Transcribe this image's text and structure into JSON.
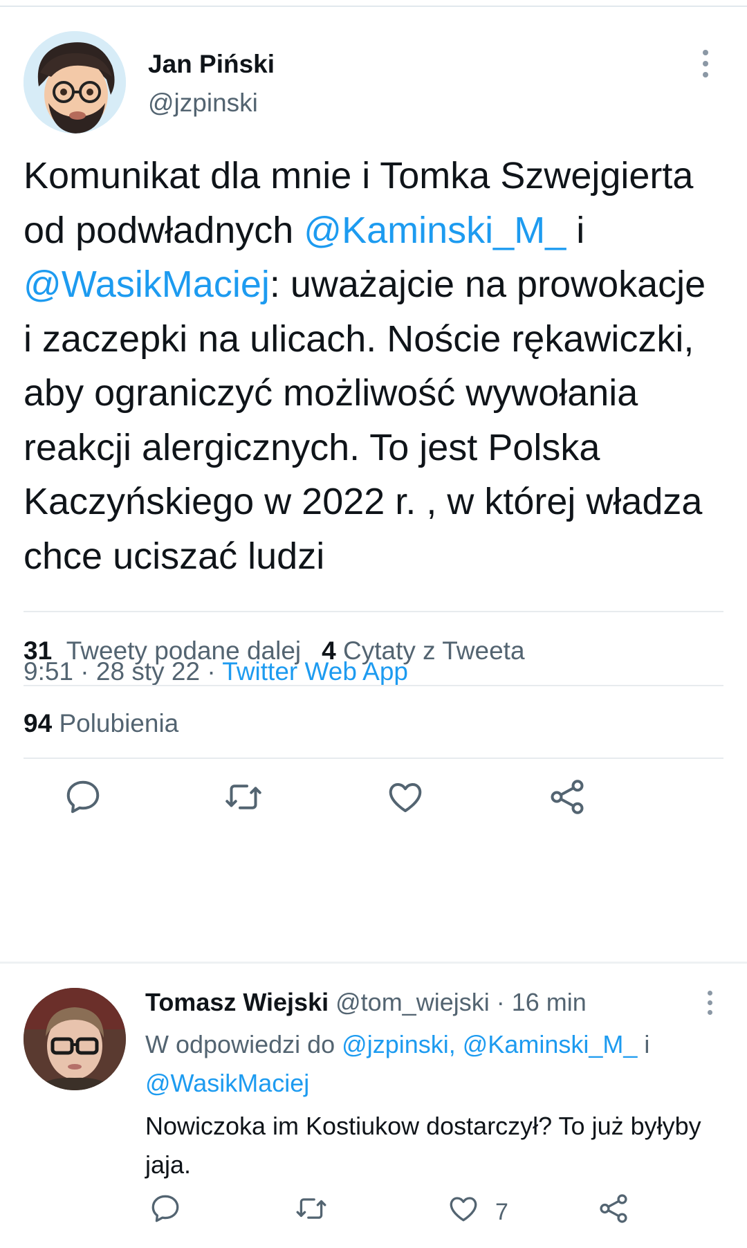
{
  "tweet": {
    "author_name": "Jan Piński",
    "author_handle": "@jzpinski",
    "text_parts": [
      "Komunikat dla mnie i Tomka Szwejgierta od podwładnych ",
      "@Kaminski_M_",
      " i ",
      "@WasikMaciej",
      ": uważajcie na prowokacje i zaczepki na ulicach. Noście rękawiczki, aby ograniczyć możliwość wywołania reakcji alergicznych. To jest Polska Kaczyńskiego w 2022 r. , w której władza chce uciszać ludzi"
    ],
    "time": "9:51",
    "date": "28 sty 22",
    "source": "Twitter Web App",
    "separator": " · ",
    "retweets_count": "31",
    "retweets_label": "Tweety podane dalej",
    "quotes_count": "4",
    "quotes_label": "Cytaty z Tweeta",
    "likes_count": "94",
    "likes_label": "Polubienia",
    "icons": [
      "reply-icon",
      "retweet-icon",
      "like-icon",
      "share-icon",
      "more-icon"
    ]
  },
  "reply": {
    "author_name": "Tomasz Wiejski",
    "author_handle": "@tom_wiejski",
    "time_ago": "16 min",
    "separator": " · ",
    "reply_to_label": "W odpowiedzi do ",
    "reply_to_1": "@jzpinski,",
    "reply_to_2": "@Kaminski_M_",
    "reply_to_and": " i ",
    "reply_to_3": "@WasikMaciej",
    "text": "Nowiczoka im Kostiukow dostarczył? To już byłyby jaja.",
    "like_count": "7"
  },
  "colors": {
    "accent": "#1d9bf0",
    "secondary_text": "#536471",
    "primary_text": "#0f1419",
    "divider": "#e7ebee"
  }
}
